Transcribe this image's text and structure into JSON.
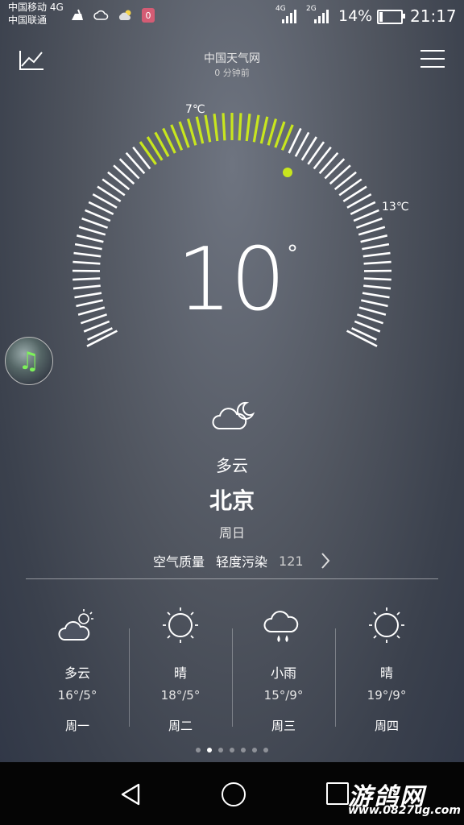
{
  "status_bar": {
    "carrier_1": "中国移动 4G",
    "carrier_2": "中国联通",
    "sim1_net": "4G",
    "sim2_net": "2G",
    "battery": "14%",
    "battery_level": 0.14,
    "time": "21:17",
    "notification_icons": [
      "cleaner-icon",
      "cloud-icon",
      "weather-icon",
      "app-badge-icon"
    ]
  },
  "header": {
    "source": "中国天气网",
    "updated": "0 分钟前",
    "left_icon": "trend-chart-icon",
    "right_icon": "menu-icon"
  },
  "current": {
    "temperature": "10",
    "degree_symbol": "°",
    "min_temp": "7℃",
    "max_temp": "13℃",
    "condition": "多云",
    "condition_icon": "cloudy-night-icon",
    "city": "北京",
    "weekday": "周日"
  },
  "air_quality": {
    "label": "空气质量",
    "level": "轻度污染",
    "value": "121"
  },
  "forecast": [
    {
      "condition": "多云",
      "temps": "16°/5°",
      "day": "周一",
      "icon": "partly-cloudy-icon"
    },
    {
      "condition": "晴",
      "temps": "18°/5°",
      "day": "周二",
      "icon": "sun-icon"
    },
    {
      "condition": "小雨",
      "temps": "15°/9°",
      "day": "周三",
      "icon": "light-rain-icon"
    },
    {
      "condition": "晴",
      "temps": "19°/9°",
      "day": "周四",
      "icon": "sun-icon"
    }
  ],
  "pager": {
    "count": 7,
    "active": 1
  },
  "music_button_icon": "music-note-icon",
  "watermark": {
    "text": "游鸽网",
    "url": "www.0827ug.com"
  },
  "colors": {
    "accent": "#c8e61e",
    "background": "#4a505c"
  }
}
